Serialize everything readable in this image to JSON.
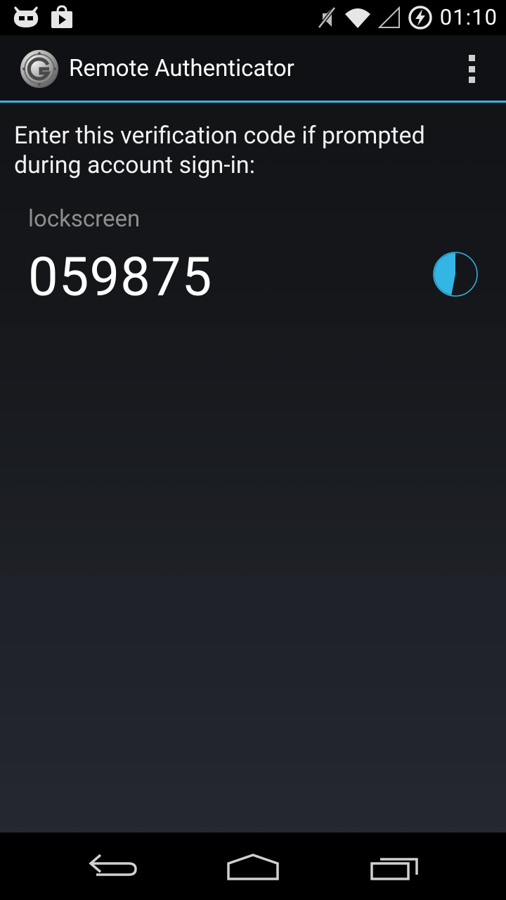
{
  "status_bar": {
    "time": "01:10",
    "icons": [
      "cyanogenmod-icon",
      "play-store-icon",
      "mute-icon",
      "wifi-icon",
      "cell-signal-icon",
      "battery-charging-icon"
    ]
  },
  "action_bar": {
    "title": "Remote Authenticator",
    "icon": "app-icon",
    "menu": "overflow-menu-icon"
  },
  "main": {
    "prompt": "Enter this verification code if prompted during account sign-in:",
    "account": {
      "name": "lockscreen",
      "code": "059875",
      "remaining_fraction": 0.47
    }
  },
  "nav_bar": {
    "buttons": [
      "back-icon",
      "home-icon",
      "recents-icon"
    ]
  },
  "colors": {
    "accent": "#33b5e5",
    "status_bar_bg": "#000000",
    "action_bar_bg": "#101114",
    "secondary_text": "#8e8e8e"
  }
}
